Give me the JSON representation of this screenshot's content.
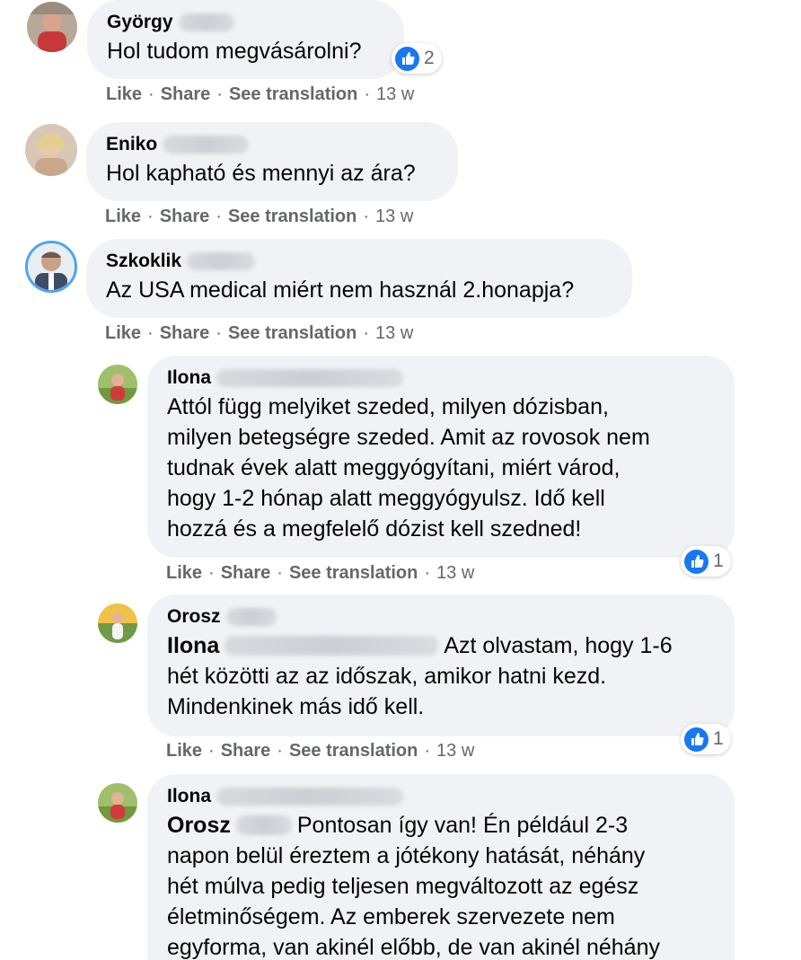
{
  "actions": {
    "like": "Like",
    "share": "Share",
    "translate": "See translation",
    "separator": "·"
  },
  "colors": {
    "bubble": "#f0f2f5",
    "meta_text": "#65676b",
    "like_blue": "#1877f2"
  },
  "comments": [
    {
      "author": "György",
      "text": "Hol tudom megvásárolni?",
      "time": "13 w",
      "reaction_icon": "thumbs-up-icon",
      "reaction_count": "2"
    },
    {
      "author": "Eniko",
      "text": "Hol kapható és mennyi az ára?",
      "time": "13 w"
    },
    {
      "author": "Szkoklik",
      "text": "Az USA medical miért nem használ 2.honapja?",
      "time": "13 w"
    },
    {
      "author": "Ilona",
      "text": "Attól függ melyiket szeded, milyen dózisban,\nmilyen betegségre szeded. Amit az rovosok nem\ntudnak évek alatt meggyógyítani, miért várod,\nhogy 1-2 hónap alatt meggyógyulsz. Idő kell\nhozzá és a megfelelő dózist kell szedned!",
      "time": "13 w",
      "reaction_icon": "thumbs-up-icon",
      "reaction_count": "1"
    },
    {
      "author": "Orosz",
      "mention": "Ilona",
      "text_first": "Azt olvastam, hogy 1-6",
      "text_rest": "hét közötti az az időszak, amikor hatni kezd.\nMindenkinek más idő kell.",
      "time": "13 w",
      "reaction_icon": "thumbs-up-icon",
      "reaction_count": "1"
    },
    {
      "author": "Ilona",
      "mention": "Orosz",
      "text_first": "Pontosan így van! Én például 2-3",
      "text_rest": "napon belül éreztem a jótékony hatását, néhány\nhét múlva pedig teljesen megváltozott az egész\néletminőségem. Az emberek szervezete nem\negyforma, van akinél előbb, de van akinél néhány"
    }
  ]
}
